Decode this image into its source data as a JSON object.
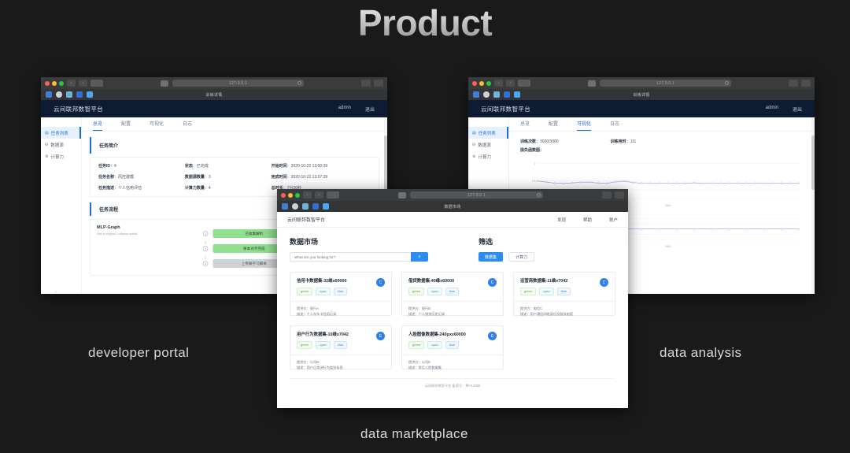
{
  "slide": {
    "title": "Product",
    "captions": {
      "developer": "developer portal",
      "marketplace": "data marketplace",
      "analysis": "data analysis"
    }
  },
  "browser": {
    "url_text": "127.0.0.1",
    "nav_back": "‹",
    "nav_fwd": "›",
    "refresh": "↻"
  },
  "developer_portal": {
    "tab_title": "训练详情",
    "app_name": "云间联邦数智平台",
    "user": "admin",
    "logout": "退出",
    "sidebar": [
      {
        "icon": "▤",
        "label": "任务列表",
        "active": true
      },
      {
        "icon": "⛁",
        "label": "数据源",
        "active": false
      },
      {
        "icon": "⚙",
        "label": "计算力",
        "active": false
      }
    ],
    "tabs": [
      {
        "label": "总览",
        "active": true
      },
      {
        "label": "配置",
        "active": false
      },
      {
        "label": "可视化",
        "active": false
      },
      {
        "label": "日志",
        "active": false
      }
    ],
    "panel_title": "任务简介",
    "info": [
      {
        "key": "任务ID",
        "value": "4"
      },
      {
        "key": "状态",
        "value": "已完成"
      },
      {
        "key": "开始时间",
        "value": "2020-10-22 13:00:39"
      },
      {
        "key": "任务名称",
        "value": "风控建模"
      },
      {
        "key": "数据源数量",
        "value": "3"
      },
      {
        "key": "完成时间",
        "value": "2020-10-22 13:07:39"
      },
      {
        "key": "任务描述",
        "value": "个人信用评估"
      },
      {
        "key": "计算力数量",
        "value": "4"
      },
      {
        "key": "总时长",
        "value": "7分20秒"
      }
    ],
    "section_title": "任务流程",
    "flow": {
      "label": "MLP-Graph",
      "sublabel": "click to expand / collapse details",
      "steps": [
        {
          "num": "1",
          "label": "已收集解析",
          "state": "green"
        },
        {
          "num": "2",
          "label": "样本对齐完成",
          "state": "green"
        },
        {
          "num": "3",
          "label": "上传联学习脚本",
          "state": "gray"
        }
      ]
    },
    "collapse": "‹"
  },
  "data_analysis": {
    "tab_title": "训练详情",
    "app_name": "云间联邦数智平台",
    "user": "admin",
    "logout": "退出",
    "sidebar": [
      {
        "icon": "▤",
        "label": "任务列表",
        "active": true
      },
      {
        "icon": "⛁",
        "label": "数据源",
        "active": false
      },
      {
        "icon": "⚙",
        "label": "计算力",
        "active": false
      }
    ],
    "tabs": [
      {
        "label": "总览",
        "active": false
      },
      {
        "label": "配置",
        "active": false
      },
      {
        "label": "可视化",
        "active": true
      },
      {
        "label": "日志",
        "active": false
      }
    ],
    "stats": [
      {
        "key": "训练次数",
        "value": "3000/3000"
      },
      {
        "key": "训练用时",
        "value": "111"
      }
    ],
    "chart_caption": "损失函数图："
  },
  "chart_data": [
    {
      "type": "line",
      "title": "损失函数图",
      "xlabel": "",
      "ylabel": "",
      "ylim": [
        0.6,
        1.05
      ],
      "yticks": [
        1,
        0.8,
        0.7,
        0.6
      ],
      "ytick_labels": [
        "1",
        "0.8",
        "0.7",
        "0.6"
      ],
      "x": [
        0,
        100,
        200,
        300,
        400,
        500,
        600,
        700,
        800,
        900,
        1000,
        1100,
        1200,
        1300,
        1400,
        1500,
        1600,
        1700,
        1800,
        1900,
        2000,
        2100,
        2200,
        2300,
        2400,
        2500,
        2600,
        2700,
        2800,
        2900,
        3000
      ],
      "xticks": [
        1000,
        1500
      ],
      "xtick_labels": [
        "1000",
        "1500"
      ],
      "values": [
        0.8,
        0.79,
        0.775,
        0.772,
        0.778,
        0.786,
        0.787,
        0.776,
        0.773,
        0.792,
        0.798,
        0.783,
        0.776,
        0.775,
        0.775,
        0.774,
        0.774,
        0.774,
        0.779,
        0.774,
        0.774,
        0.774,
        0.774,
        0.775,
        0.775,
        0.774,
        0.774,
        0.774,
        0.774,
        0.774,
        0.774
      ],
      "grid": true,
      "legend": "none",
      "series_color": "#8fa8d4"
    },
    {
      "type": "line",
      "title": "",
      "xlabel": "",
      "ylabel": "",
      "ylim": [
        0.6,
        1.05
      ],
      "yticks": [],
      "ytick_labels": [],
      "x": [
        0,
        200,
        400,
        600,
        800,
        1000,
        1200,
        1400,
        1600,
        1800,
        2000,
        2200,
        2400,
        2600,
        2800,
        3000
      ],
      "xticks": [
        1000,
        1500
      ],
      "xtick_labels": [
        "1000",
        "1500"
      ],
      "values": [
        0.8,
        0.8,
        0.8,
        0.8,
        0.8,
        0.8,
        0.8,
        0.8,
        0.8,
        0.8,
        0.8,
        0.8,
        0.8,
        0.8,
        0.8,
        0.8
      ],
      "grid": true,
      "legend": "none",
      "series_color": "#8fa8d4"
    }
  ],
  "marketplace": {
    "tab_title": "数据市场",
    "app_name": "云间联邦数智平台",
    "nav": [
      "发现",
      "帮助",
      "账户"
    ],
    "market_heading": "数据市场",
    "search_placeholder": "What are you looking for?",
    "search_value": "",
    "search_icon": "⌕",
    "filter_heading": "筛选",
    "filters": [
      {
        "label": "数据集",
        "active": true
      },
      {
        "label": "计算力",
        "active": false
      }
    ],
    "cards": [
      {
        "title": "信用卡数据集-32维x60000",
        "tags": [
          "green",
          "cyan",
          "blue"
        ],
        "badge": "C",
        "provider": "提供方：银行A",
        "desc": "描述：个人存年卡信用记录"
      },
      {
        "title": "借贷数据集-40维x60000",
        "tags": [
          "green",
          "cyan",
          "blue"
        ],
        "badge": "C",
        "provider": "提供方：银行B",
        "desc": "描述：个人借贷历史记录"
      },
      {
        "title": "运营商数据集-11维x7042",
        "tags": [
          "green",
          "cyan",
          "blue"
        ],
        "badge": "C",
        "provider": "提供方：电信C",
        "desc": "描述：用户通信网络身份及服务制度"
      },
      {
        "title": "用户行为数据集-10维x7042",
        "tags": [
          "green",
          "cyan",
          "blue"
        ],
        "badge": "E",
        "provider": "提供方：公司D",
        "desc": "描述：用户日常浏行为类别标签"
      },
      {
        "title": "人脸图像数据集-240pxx60000",
        "tags": [
          "green",
          "cyan",
          "blue"
        ],
        "badge": "E",
        "provider": "提供方：公司E",
        "desc": "描述：常见人脸数据集"
      }
    ],
    "footer": "云间联邦数智平台  备案号：粤H12386"
  }
}
